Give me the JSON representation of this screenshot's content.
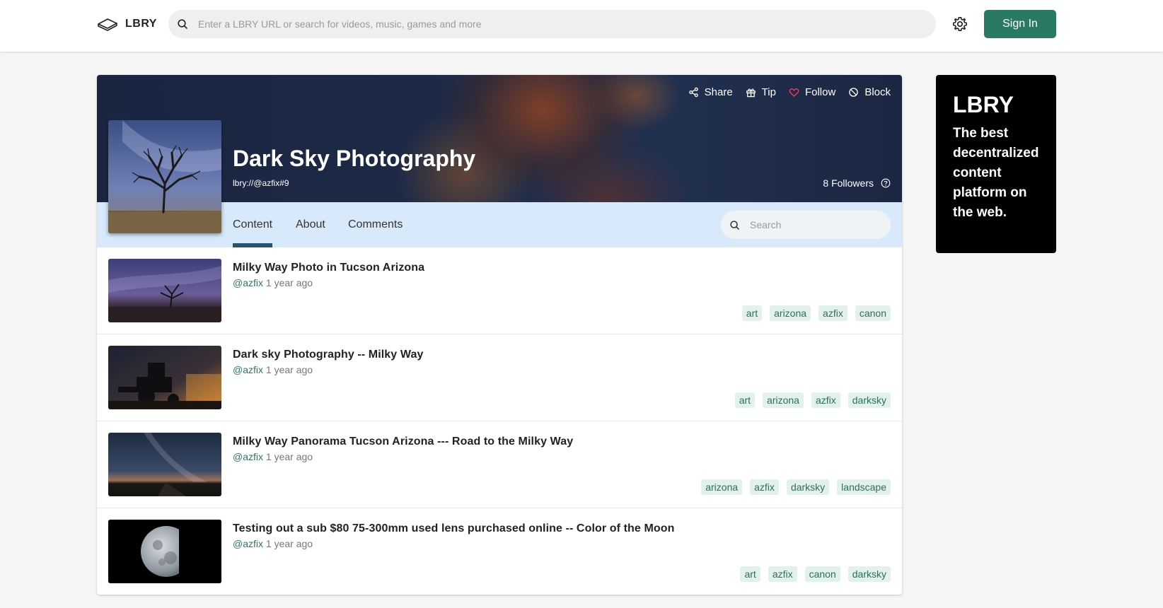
{
  "header": {
    "logo_text": "LBRY",
    "search_placeholder": "Enter a LBRY URL or search for videos, music, games and more",
    "signin_label": "Sign In"
  },
  "channel": {
    "title": "Dark Sky Photography",
    "url": "lbry://@azfix#9",
    "followers": "8 Followers",
    "actions": {
      "share": "Share",
      "tip": "Tip",
      "follow": "Follow",
      "block": "Block"
    },
    "tabs": [
      "Content",
      "About",
      "Comments"
    ],
    "active_tab": "Content",
    "search_placeholder": "Search"
  },
  "content": [
    {
      "title": "Milky Way Photo in Tucson Arizona",
      "author": "@azfix",
      "time": "1 year ago",
      "tags": [
        "art",
        "arizona",
        "azfix",
        "canon"
      ]
    },
    {
      "title": "Dark sky Photography -- Milky Way",
      "author": "@azfix",
      "time": "1 year ago",
      "tags": [
        "art",
        "arizona",
        "azfix",
        "darksky"
      ]
    },
    {
      "title": "Milky Way Panorama Tucson Arizona --- Road to the Milky Way",
      "author": "@azfix",
      "time": "1 year ago",
      "tags": [
        "arizona",
        "azfix",
        "darksky",
        "landscape"
      ]
    },
    {
      "title": "Testing out a sub $80 75-300mm used lens purchased online -- Color of the Moon",
      "author": "@azfix",
      "time": "1 year ago",
      "tags": [
        "art",
        "azfix",
        "canon",
        "darksky"
      ]
    }
  ],
  "ad": {
    "title": "LBRY",
    "text": "The best decentralized content platform on the web."
  },
  "colors": {
    "accent": "#2a7a63",
    "tabs_bg": "#d8e9fb",
    "tab_active": "#27546e",
    "tag_bg": "#e3f1ec",
    "heart": "#e0405a"
  }
}
